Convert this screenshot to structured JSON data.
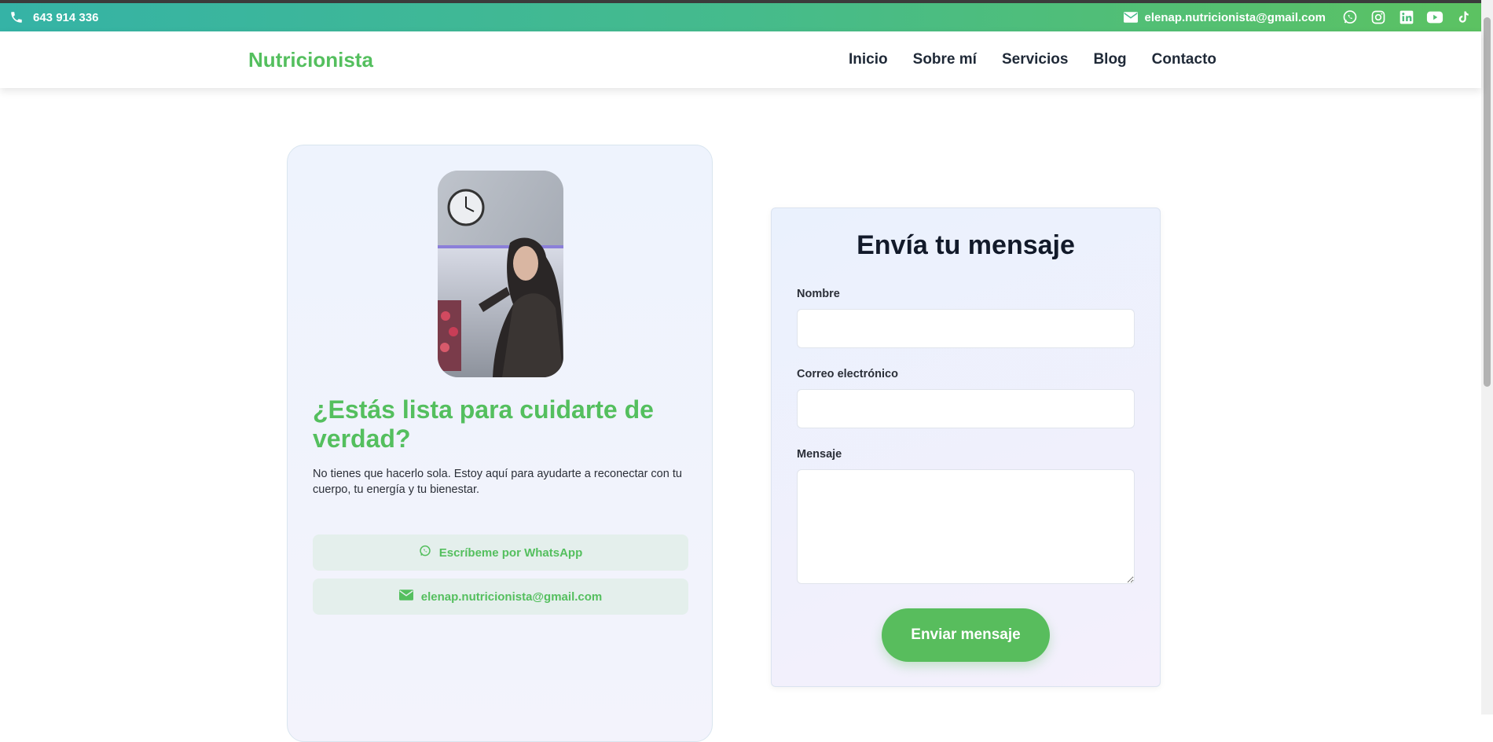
{
  "topbar": {
    "phone": "643 914 336",
    "email": "elenap.nutricionista@gmail.com",
    "social": [
      "whatsapp-icon",
      "instagram-icon",
      "linkedin-icon",
      "youtube-icon",
      "tiktok-icon"
    ],
    "gradient": [
      "#35b3a6",
      "#5cc262"
    ]
  },
  "header": {
    "logo": "Nutricionista",
    "nav": [
      "Inicio",
      "Sobre mí",
      "Servicios",
      "Blog",
      "Contacto"
    ]
  },
  "cta": {
    "title": "¿Estás lista para cuidarte de verdad?",
    "text": "No tienes que hacerlo sola. Estoy aquí para ayudarte a reconectar con tu cuerpo, tu energía y tu bienestar.",
    "whatsapp_button": "Escríbeme por WhatsApp",
    "email_button": "elenap.nutricionista@gmail.com"
  },
  "form": {
    "title": "Envía tu mensaje",
    "name_label": "Nombre",
    "name_value": "",
    "email_label": "Correo electrónico",
    "email_value": "",
    "message_label": "Mensaje",
    "message_value": "",
    "submit": "Enviar mensaje"
  },
  "colors": {
    "accent": "#54bf5e",
    "text_dark": "#1f2937",
    "card_bg": "#eef3fd"
  }
}
